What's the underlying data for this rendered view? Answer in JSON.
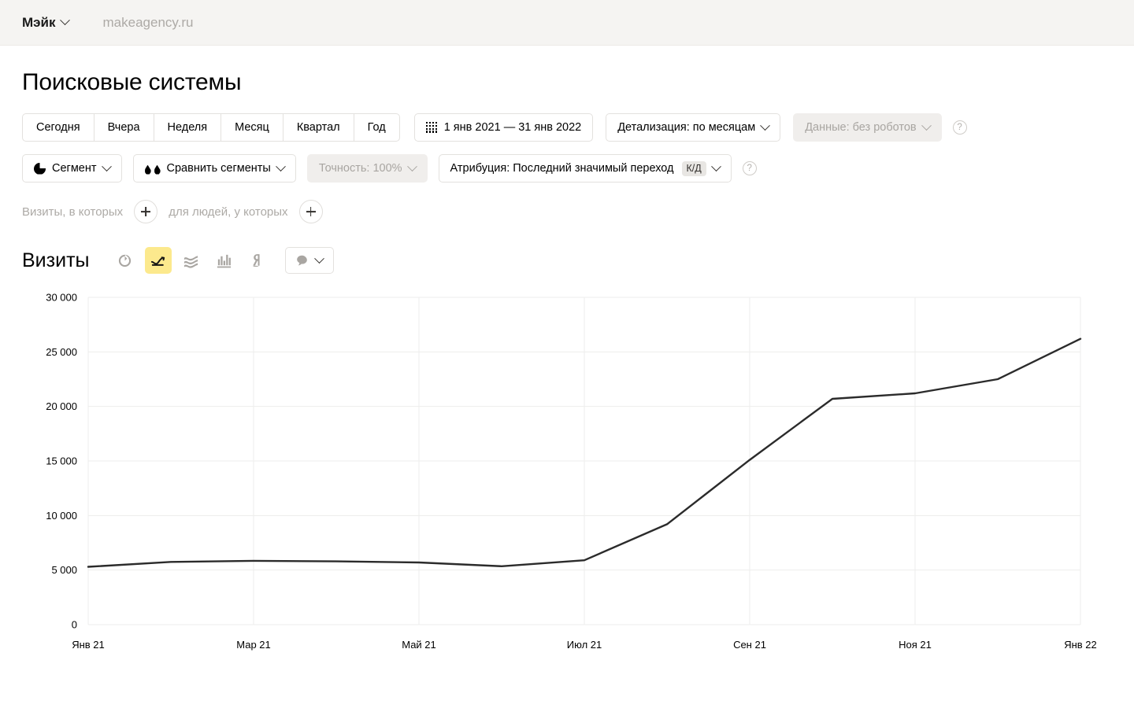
{
  "topbar": {
    "counter_name": "Мэйк",
    "counter_domain": "makeagency.ru"
  },
  "page": {
    "title": "Поисковые системы"
  },
  "period_buttons": [
    {
      "label": "Сегодня"
    },
    {
      "label": "Вчера"
    },
    {
      "label": "Неделя"
    },
    {
      "label": "Месяц"
    },
    {
      "label": "Квартал"
    },
    {
      "label": "Год"
    }
  ],
  "date_range": {
    "label": "1 янв 2021 — 31 янв 2022",
    "icon": "calendar-grid-icon"
  },
  "detail": {
    "label": "Детализация: по месяцам"
  },
  "data_source": {
    "label": "Данные: без роботов",
    "disabled": true
  },
  "help": {
    "glyph": "?"
  },
  "segment": {
    "label": "Сегмент",
    "icon": "pie-chart-icon"
  },
  "compare_segments": {
    "label": "Сравнить сегменты",
    "icon": "compare-drops-icon"
  },
  "accuracy": {
    "label": "Точность: 100%",
    "disabled": true
  },
  "attribution": {
    "label": "Атрибуция: Последний значимый переход",
    "badge": "К/Д"
  },
  "filters": {
    "visits_label": "Визиты, в которых",
    "people_label": "для людей, у которых",
    "add_glyph": "+"
  },
  "metric": {
    "title": "Визиты",
    "viz_buttons": [
      {
        "icon": "pie-chart-icon",
        "name": "viz-pie",
        "active": false
      },
      {
        "icon": "line-chart-icon",
        "name": "viz-line",
        "active": true
      },
      {
        "icon": "area-chart-icon",
        "name": "viz-area",
        "active": false
      },
      {
        "icon": "bar-chart-icon",
        "name": "viz-bar",
        "active": false
      },
      {
        "icon": "map-pin-icon",
        "name": "viz-map",
        "active": false
      }
    ],
    "comments_button": {
      "icon": "comment-bubble-icon",
      "name": "comments-dropdown"
    }
  },
  "colors": {
    "accent_yellow": "#FCE98D",
    "line": "#2B2B2B",
    "grid": "#EDEDEC",
    "topbar_bg": "#F5F4F2",
    "muted_text": "#ADAAA6"
  },
  "chart_data": {
    "type": "line",
    "title": "Визиты",
    "xlabel": "",
    "ylabel": "",
    "grid": true,
    "legend": false,
    "ylim": [
      0,
      30000
    ],
    "yticks": [
      0,
      5000,
      10000,
      15000,
      20000,
      25000,
      30000
    ],
    "ytick_labels": [
      "0",
      "5 000",
      "10 000",
      "15 000",
      "20 000",
      "25 000",
      "30 000"
    ],
    "x": [
      "Янв 21",
      "Фев 21",
      "Мар 21",
      "Апр 21",
      "Май 21",
      "Июн 21",
      "Июл 21",
      "Авг 21",
      "Сен 21",
      "Окт 21",
      "Ноя 21",
      "Дек 21",
      "Янв 22"
    ],
    "xtick_labels": [
      "Янв 21",
      "Мар 21",
      "Май 21",
      "Июл 21",
      "Сен 21",
      "Ноя 21",
      "Янв 22"
    ],
    "series": [
      {
        "name": "Визиты",
        "color": "#2B2B2B",
        "values": [
          5300,
          5750,
          5850,
          5800,
          5700,
          5350,
          5900,
          9200,
          15100,
          20700,
          21200,
          22500,
          26200
        ]
      }
    ]
  }
}
